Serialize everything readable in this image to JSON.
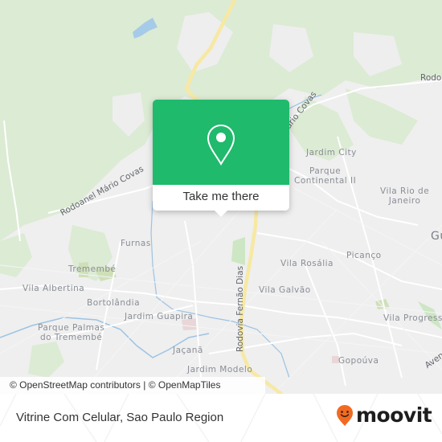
{
  "map": {
    "attribution": "© OpenStreetMap contributors | © OpenMapTiles",
    "colors": {
      "land": "#efefef",
      "park": "#dcebd4",
      "road": "#ffffff",
      "highway": "#f7e8a3",
      "water": "#a6cbe8",
      "popup": "#1fba6c"
    },
    "place_labels": [
      {
        "id": "jardim-city",
        "text": "Jardim City"
      },
      {
        "id": "parque-continental",
        "text": "Parque\nContinental II"
      },
      {
        "id": "vila-rio",
        "text": "Vila Rio de\nJaneiro"
      },
      {
        "id": "furnas",
        "text": "Furnas"
      },
      {
        "id": "tremembe",
        "text": "Tremembé"
      },
      {
        "id": "vila-albertina",
        "text": "Vila Albertina"
      },
      {
        "id": "bortolandia",
        "text": "Bortolândia"
      },
      {
        "id": "jardim-guapira",
        "text": "Jardim Guapira"
      },
      {
        "id": "parque-palmas",
        "text": "Parque Palmas\ndo Tremembé"
      },
      {
        "id": "jacana",
        "text": "Jaçanã"
      },
      {
        "id": "jardim-modelo",
        "text": "Jardim Modelo"
      },
      {
        "id": "vila-rosalia",
        "text": "Vila Rosália"
      },
      {
        "id": "picanco",
        "text": "Picanço"
      },
      {
        "id": "vila-galvao",
        "text": "Vila Galvão"
      },
      {
        "id": "vila-progresso",
        "text": "Vila Progresso"
      },
      {
        "id": "gopouva",
        "text": "Gopoúva"
      },
      {
        "id": "gu",
        "text": "Gu"
      }
    ],
    "road_labels": [
      {
        "id": "rodoanel-left",
        "text": "Rodoanel Mário Covas"
      },
      {
        "id": "rodoanel-popup",
        "text": "Mário Covas"
      },
      {
        "id": "rodo-right",
        "text": "Rodo"
      },
      {
        "id": "fernao-dias",
        "text": "Rodovia Fernão Dias"
      },
      {
        "id": "avenida",
        "text": "Aven"
      }
    ]
  },
  "popup": {
    "icon": "map-pin-icon",
    "button_label": "Take me there"
  },
  "footer": {
    "title": "Vitrine Com Celular, Sao Paulo Region",
    "brand": "moovit",
    "brand_color": "#f26a21"
  }
}
